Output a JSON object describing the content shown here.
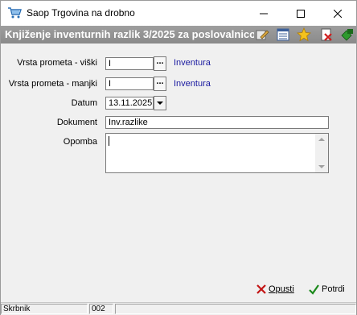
{
  "window": {
    "title": "Saop Trgovina na drobno"
  },
  "header": {
    "title": "Knjiženje inventurnih razlik 3/2025 za poslovalnico"
  },
  "toolbar_icons": [
    "edit-icon",
    "list-icon",
    "favorite-star-icon",
    "delete-icon",
    "exit-icon"
  ],
  "form": {
    "surplus": {
      "label": "Vrsta prometa - viški",
      "value": "I",
      "lookup_text": "Inventura"
    },
    "deficit": {
      "label": "Vrsta prometa - manjki",
      "value": "I",
      "lookup_text": "Inventura"
    },
    "date": {
      "label": "Datum",
      "value": "13.11.2025"
    },
    "document": {
      "label": "Dokument",
      "value": "Inv.razlike"
    },
    "note": {
      "label": "Opomba",
      "value": ""
    },
    "lookup_button": "..."
  },
  "buttons": {
    "cancel": "Opusti",
    "confirm": "Potrdi"
  },
  "statusbar": {
    "user": "Skrbnik",
    "code": "002",
    "info": ""
  }
}
